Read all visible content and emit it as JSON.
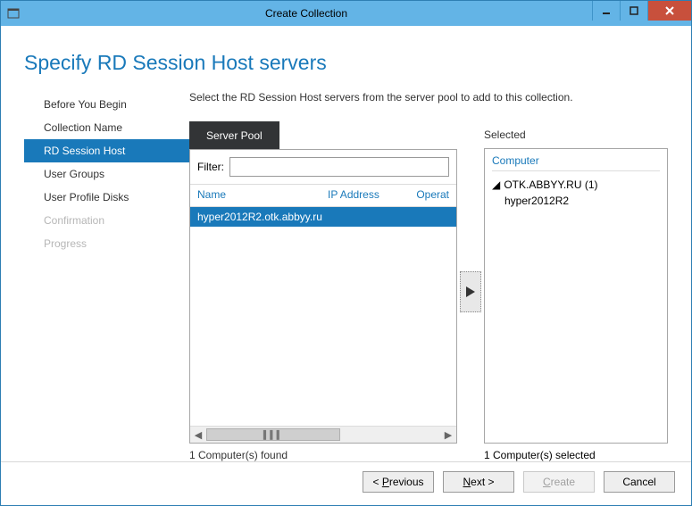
{
  "window": {
    "title": "Create Collection"
  },
  "page": {
    "heading": "Specify RD Session Host servers",
    "instruction": "Select the RD Session Host servers from the server pool to add to this collection."
  },
  "sidebar": {
    "items": [
      {
        "label": "Before You Begin",
        "state": "normal"
      },
      {
        "label": "Collection Name",
        "state": "normal"
      },
      {
        "label": "RD Session Host",
        "state": "active"
      },
      {
        "label": "User Groups",
        "state": "normal"
      },
      {
        "label": "User Profile Disks",
        "state": "normal"
      },
      {
        "label": "Confirmation",
        "state": "disabled"
      },
      {
        "label": "Progress",
        "state": "disabled"
      }
    ]
  },
  "server_pool": {
    "tab_label": "Server Pool",
    "filter_label": "Filter:",
    "filter_value": "",
    "columns": {
      "name": "Name",
      "ip": "IP Address",
      "os": "Operat"
    },
    "rows": [
      {
        "name": "hyper2012R2.otk.abbyy.ru"
      }
    ],
    "found_label": "1 Computer(s) found"
  },
  "selected": {
    "title": "Selected",
    "header": "Computer",
    "tree": {
      "group": "OTK.ABBYY.RU (1)",
      "items": [
        "hyper2012R2"
      ]
    },
    "count_label": "1 Computer(s) selected"
  },
  "footer": {
    "previous": "< Previous",
    "next": "Next >",
    "create": "Create",
    "cancel": "Cancel"
  }
}
